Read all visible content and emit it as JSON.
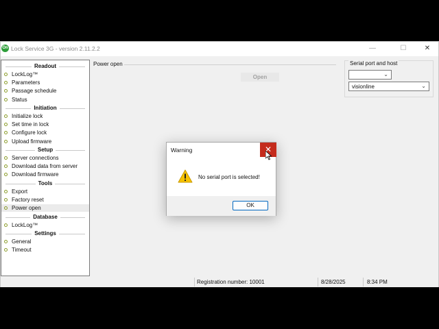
{
  "window": {
    "title": "Lock Service 3G - version 2.11.2.2",
    "icon_glyph": "On",
    "minimize_glyph": "—",
    "maximize_glyph": "☐",
    "close_glyph": "✕"
  },
  "sidebar": {
    "sections": [
      {
        "title": "Readout",
        "items": [
          "LockLog™",
          "Parameters",
          "Passage schedule",
          "Status"
        ]
      },
      {
        "title": "Initiation",
        "items": [
          "Initialize lock",
          "Set time in lock",
          "Configure lock",
          "Upload firmware"
        ]
      },
      {
        "title": "Setup",
        "items": [
          "Server connections",
          "Download data from server",
          "Download firmware"
        ]
      },
      {
        "title": "Tools",
        "items": [
          "Export",
          "Factory reset",
          "Power open"
        ]
      },
      {
        "title": "Database",
        "items": [
          "LockLog™"
        ]
      },
      {
        "title": "Settings",
        "items": [
          "General",
          "Timeout"
        ]
      }
    ],
    "selected_item": "Power open"
  },
  "main": {
    "group_title": "Power open",
    "open_button": "Open"
  },
  "serial": {
    "group_title": "Serial port and host",
    "port_value": "",
    "host_value": "visionline"
  },
  "statusbar": {
    "registration": "Registration number: 10001",
    "date": "8/28/2025",
    "time": "8:34 PM"
  },
  "dialog": {
    "title": "Warning",
    "message": "No serial port is selected!",
    "ok_label": "OK",
    "close_glyph": "✕",
    "icon": "warning-icon"
  },
  "colors": {
    "close_red": "#c42b1c",
    "bullet_olive": "#8a9b28",
    "warning_yellow": "#f7c200",
    "ok_border": "#0067c0"
  }
}
